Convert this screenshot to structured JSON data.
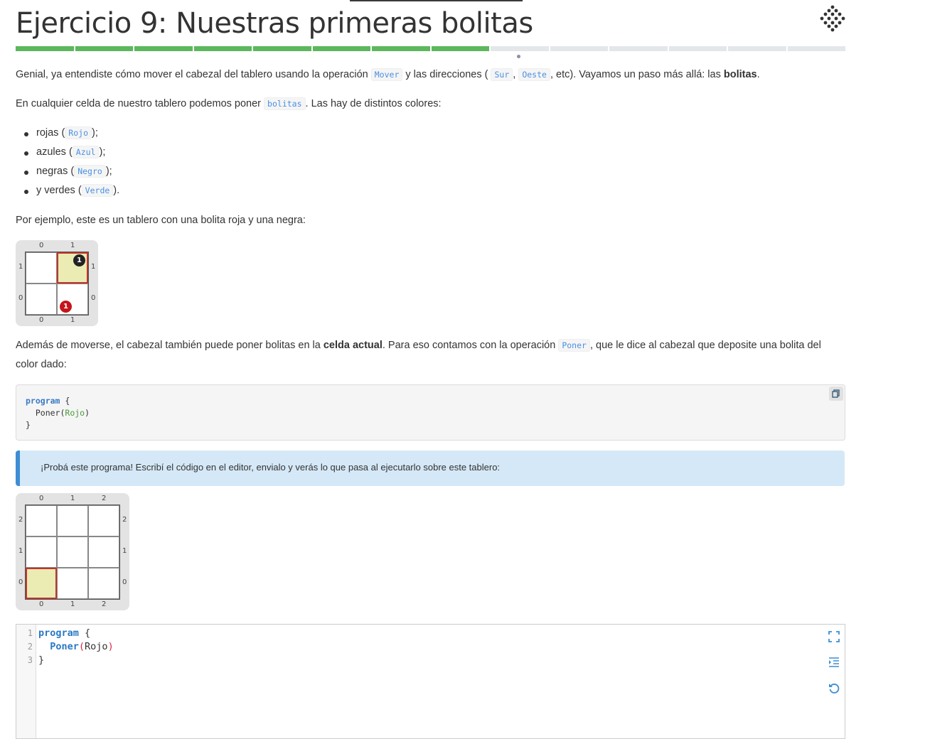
{
  "page": {
    "title": "Ejercicio 9: Nuestras primeras bolitas",
    "progress": {
      "total": 14,
      "completed": 8,
      "current": 9
    }
  },
  "intro": {
    "p1_a": "Genial, ya entendiste cómo mover el cabezal del tablero usando la operación",
    "p1_code_mover": "Mover",
    "p1_b": "y las direcciones (",
    "p1_code_sur": "Sur",
    "p1_c": ",",
    "p1_code_oeste": "Oeste",
    "p1_d": ", etc). Vayamos un paso más allá: las",
    "p1_bold": "bolitas",
    "p1_e": ".",
    "p2_a": "En cualquier celda de nuestro tablero podemos poner",
    "p2_code": "bolitas",
    "p2_b": ". Las hay de distintos colores:"
  },
  "colors": [
    {
      "pre": "rojas (",
      "code": "Rojo",
      "post": ");"
    },
    {
      "pre": "azules (",
      "code": "Azul",
      "post": ");"
    },
    {
      "pre": "negras (",
      "code": "Negro",
      "post": ");"
    },
    {
      "pre": "y verdes (",
      "code": "Verde",
      "post": ")."
    }
  ],
  "example": {
    "text": "Por ejemplo, este es un tablero con una bolita roja y una negra:",
    "board": {
      "x_labels": [
        "0",
        "1"
      ],
      "y_labels": [
        "1",
        "0"
      ],
      "black_ball": "1",
      "red_ball": "1"
    }
  },
  "explain": {
    "a": "Además de moverse, el cabezal también puede poner bolitas en la",
    "bold": "celda actual",
    "b": ". Para eso contamos con la operación",
    "code": "Poner",
    "c": ", que le dice al cabezal que deposite una bolita del color dado:"
  },
  "code_sample": {
    "line1_kw": "program",
    "line1_rest": " {",
    "line2_fn": "  Poner(",
    "line2_arg": "Rojo",
    "line2_end": ")",
    "line3": "}"
  },
  "hint": {
    "text": "¡Probá este programa! Escribí el código en el editor, envialo y verás lo que pasa al ejecutarlo sobre este tablero:"
  },
  "board2": {
    "x_labels": [
      "0",
      "1",
      "2"
    ],
    "y_labels": [
      "2",
      "1",
      "0"
    ]
  },
  "editor": {
    "line_numbers": [
      "1",
      "2",
      "3"
    ],
    "l1_kw": "program",
    "l1_rest": " {",
    "l2_indent": "  ",
    "l2_fn": "Poner",
    "l2_open": "(",
    "l2_arg": "Rojo",
    "l2_close": ")",
    "l3": "}"
  },
  "icons": {
    "logo": "mumuki-logo-icon",
    "copy": "copy-icon",
    "fullscreen": "fullscreen-icon",
    "indent": "indent-icon",
    "reset": "reset-icon"
  },
  "colors_theme": {
    "progress_done": "#5cb85c",
    "progress_todo": "#e4e7ea",
    "code_blue": "#4a90e2",
    "hint_bg": "#d5e8f7",
    "hint_border": "#3d8ed4",
    "head_border": "#c0352b"
  }
}
